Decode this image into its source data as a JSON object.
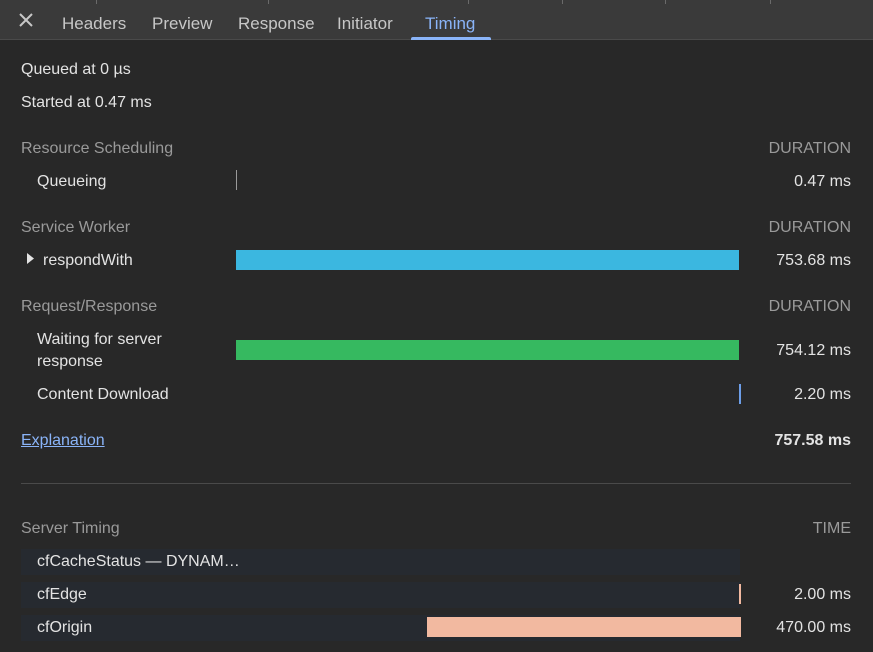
{
  "tabs": [
    "Headers",
    "Preview",
    "Response",
    "Initiator",
    "Timing"
  ],
  "active_tab": "Timing",
  "summary": {
    "queued": "Queued at 0 µs",
    "started": "Started at 0.47 ms"
  },
  "sections": {
    "scheduling": {
      "title": "Resource Scheduling",
      "col": "DURATION",
      "rows": [
        {
          "label": "Queueing",
          "value": "0.47 ms"
        }
      ]
    },
    "service_worker": {
      "title": "Service Worker",
      "col": "DURATION",
      "rows": [
        {
          "label": "respondWith",
          "value": "753.68 ms"
        }
      ]
    },
    "request_response": {
      "title": "Request/Response",
      "col": "DURATION",
      "rows": [
        {
          "label_line1": "Waiting for server",
          "label_line2": "response",
          "value": "754.12 ms"
        },
        {
          "label": "Content Download",
          "value": "2.20 ms"
        }
      ]
    },
    "total": {
      "link": "Explanation",
      "value": "757.58 ms"
    },
    "server_timing": {
      "title": "Server Timing",
      "col": "TIME",
      "rows": [
        {
          "label": "cfCacheStatus — DYNAM…",
          "value": ""
        },
        {
          "label": "cfEdge",
          "value": "2.00 ms"
        },
        {
          "label": "cfOrigin",
          "value": "470.00 ms"
        }
      ]
    }
  },
  "colors": {
    "service_worker_bar": "#3bb7e0",
    "waiting_bar": "#36b960",
    "download_bar": "#6d9ee8",
    "server_timing_bar": "#f2b9a0",
    "link": "#8ab4f8"
  }
}
